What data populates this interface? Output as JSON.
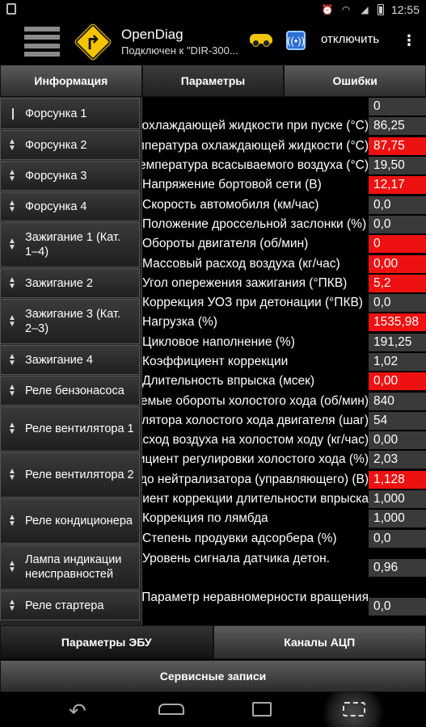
{
  "statusbar": {
    "time": "12:55"
  },
  "actionbar": {
    "app_title": "OpenDiag",
    "subtitle": "Подключен к \"DIR-300...",
    "disconnect_label": "отключить",
    "overflow": "⋮"
  },
  "tabs": [
    {
      "label": "Информация",
      "active": false
    },
    {
      "label": "Параметры",
      "active": true
    },
    {
      "label": "Ошибки",
      "active": false
    }
  ],
  "params": [
    {
      "name": "",
      "value": "0",
      "alert": false
    },
    {
      "name": "Температура охлаждающей жидкости при пуске (°C)",
      "value": "86,25",
      "alert": false
    },
    {
      "name": "Температура охлаждающей жидкости (°C)",
      "value": "87,75",
      "alert": true
    },
    {
      "name": "Температура всасываемого воздуха (°C)",
      "value": "19,50",
      "alert": false
    },
    {
      "name": "Напряжение бортовой сети (В)",
      "value": "12,17",
      "alert": true
    },
    {
      "name": "Скорость автомобиля (км/час)",
      "value": "0,0",
      "alert": false
    },
    {
      "name": "Положение дроссельной заслонки (%)",
      "value": "0,0",
      "alert": false
    },
    {
      "name": "Обороты двигателя (об/мин)",
      "value": "0",
      "alert": true
    },
    {
      "name": "Массовый расход воздуха (кг/час)",
      "value": "0,00",
      "alert": true
    },
    {
      "name": "Угол опережения зажигания (°ПКВ)",
      "value": "5,2",
      "alert": true
    },
    {
      "name": "Коррекция УОЗ при детонации (°ПКВ)",
      "value": "0,0",
      "alert": false
    },
    {
      "name": "Нагрузка (%)",
      "value": "1535,98",
      "alert": true
    },
    {
      "name": "Цикловое наполнение (%)",
      "value": "191,25",
      "alert": false
    },
    {
      "name": "Коэффициент коррекции",
      "value": "1,02",
      "alert": false
    },
    {
      "name": "Длительность впрыска (мсек)",
      "value": "0,00",
      "alert": true
    },
    {
      "name": "Желаемые обороты холостого хода (об/мин)",
      "value": "840",
      "alert": false
    },
    {
      "name": "Положение регулятора холостого хода двигателя (шаг)",
      "value": "54",
      "alert": false
    },
    {
      "name": "Желаемый расход воздуха на холостом ходу (кг/час)",
      "value": "0,00",
      "alert": false
    },
    {
      "name": "Коэффициент регулировки холостого хода (%)",
      "value": "2,03",
      "alert": false
    },
    {
      "name": "Напряжение датчика кислорода до нейтрализатора (управляющего) (В)",
      "value": "1,128",
      "alert": true
    },
    {
      "name": "Коэффициент коррекции длительности впрыска",
      "value": "1,000",
      "alert": false
    },
    {
      "name": "Коррекция по лямбда",
      "value": "1,000",
      "alert": false
    },
    {
      "name": "Степень продувки адсорбера (%)",
      "value": "0,0",
      "alert": false
    },
    {
      "name": "Уровень сигнала датчика детон.",
      "value": "0,96",
      "alert": false,
      "tall": true
    },
    {
      "name": "Параметр неравномерности вращения",
      "value": "0,0",
      "alert": false,
      "tall": true
    }
  ],
  "drawer": [
    {
      "label": "Форсунка 1",
      "icon": "bar-icon",
      "height": 39
    },
    {
      "label": "Форсунка 2",
      "icon": "updown-icon",
      "height": 37
    },
    {
      "label": "Форсунка 3",
      "icon": "updown-icon",
      "height": 37
    },
    {
      "label": "Форсунка 4",
      "icon": "updown-icon",
      "height": 37
    },
    {
      "label": "Зажигание 1 (Кат. 1–4)",
      "icon": "updown-icon",
      "height": 56
    },
    {
      "label": "Зажигание 2",
      "icon": "updown-icon",
      "height": 37
    },
    {
      "label": "Зажигание 3 (Кат. 2–3)",
      "icon": "updown-icon",
      "height": 56
    },
    {
      "label": "Зажигание 4",
      "icon": "updown-icon",
      "height": 37
    },
    {
      "label": "Реле бензонасоса",
      "icon": "updown-icon",
      "height": 37
    },
    {
      "label": "Реле вентилятора 1",
      "icon": "updown-icon",
      "height": 56
    },
    {
      "label": "Реле вентилятора 2",
      "icon": "updown-icon",
      "height": 56
    },
    {
      "label": "Реле кондиционера",
      "icon": "updown-icon",
      "height": 56
    },
    {
      "label": "Лампа индикации неисправностей",
      "icon": "updown-icon",
      "height": 56
    },
    {
      "label": "Реле стартера",
      "icon": "updown-icon",
      "height": 37
    }
  ],
  "bottom_tabs": [
    {
      "label": "Параметры ЭБУ",
      "active": true
    },
    {
      "label": "Каналы АЦП",
      "active": false
    }
  ],
  "service_label": "Сервисные записи",
  "colors": {
    "alert": "#ee1111",
    "value_bg": "#3a3a3a",
    "logo": "#f5c400",
    "wifi": "#2d6fd6"
  }
}
